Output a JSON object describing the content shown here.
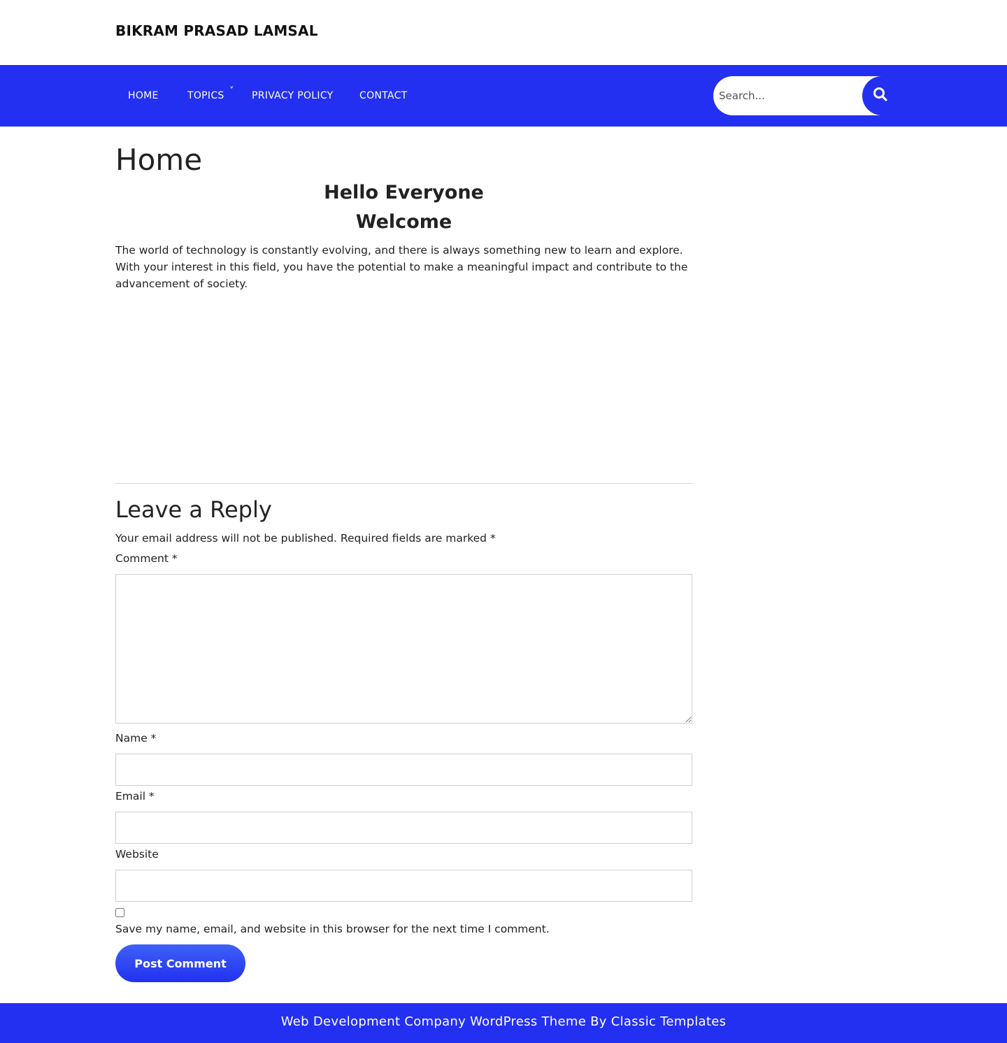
{
  "site": {
    "title": "BIKRAM PRASAD LAMSAL"
  },
  "nav": {
    "items": [
      {
        "label": "HOME"
      },
      {
        "label": "TOPICS"
      },
      {
        "label": "PRIVACY POLICY"
      },
      {
        "label": "CONTACT"
      }
    ],
    "topics_chevron": "˅"
  },
  "search": {
    "placeholder": "Search..."
  },
  "page": {
    "title": "Home",
    "heading_1": "Hello Everyone",
    "heading_2": "Welcome",
    "intro": "The world of technology is constantly evolving, and there is always something new to learn and explore. With your interest in this field, you have the potential to make a meaningful impact and contribute to the advancement of society."
  },
  "comments": {
    "title": "Leave a Reply",
    "notes": "Your email address will not be published. Required fields are marked *",
    "comment_label": "Comment *",
    "name_label": "Name *",
    "email_label": "Email *",
    "website_label": "Website",
    "save_label": "Save my name, email, and website in this browser for the next time I comment.",
    "submit_label": "Post Comment"
  },
  "footer": {
    "text": "Web Development Company WordPress Theme By Classic Templates"
  },
  "colors": {
    "brand": "#2330f2",
    "text": "#222222",
    "border": "#cfcfcf"
  }
}
